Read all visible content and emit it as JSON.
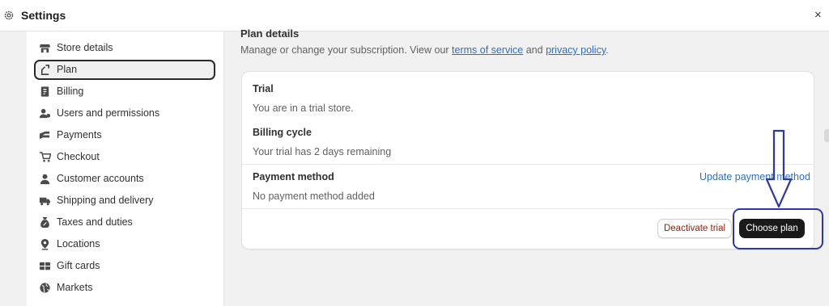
{
  "header": {
    "title": "Settings",
    "gear_icon": "gear-icon",
    "close_label": "×"
  },
  "sidebar": {
    "items": [
      {
        "label": "Store details",
        "icon": "store-icon",
        "active": false
      },
      {
        "label": "Plan",
        "icon": "plan-icon",
        "active": true
      },
      {
        "label": "Billing",
        "icon": "billing-icon",
        "active": false
      },
      {
        "label": "Users and permissions",
        "icon": "users-icon",
        "active": false
      },
      {
        "label": "Payments",
        "icon": "payments-icon",
        "active": false
      },
      {
        "label": "Checkout",
        "icon": "cart-icon",
        "active": false
      },
      {
        "label": "Customer accounts",
        "icon": "person-icon",
        "active": false
      },
      {
        "label": "Shipping and delivery",
        "icon": "truck-icon",
        "active": false
      },
      {
        "label": "Taxes and duties",
        "icon": "tax-icon",
        "active": false
      },
      {
        "label": "Locations",
        "icon": "location-icon",
        "active": false
      },
      {
        "label": "Gift cards",
        "icon": "gift-card-icon",
        "active": false
      },
      {
        "label": "Markets",
        "icon": "globe-icon",
        "active": false
      }
    ]
  },
  "main": {
    "section_title": "Plan details",
    "description_prefix": "Manage or change your subscription. View our ",
    "terms_link": "terms of service",
    "description_and": " and ",
    "privacy_link": "privacy policy",
    "description_suffix": ".",
    "card": {
      "trial_heading": "Trial",
      "trial_text": "You are in a trial store.",
      "billing_cycle_heading": "Billing cycle",
      "billing_cycle_text": "Your trial has 2 days remaining",
      "payment_method_heading": "Payment method",
      "payment_method_text": "No payment method added",
      "update_payment_link": "Update payment method",
      "deactivate_button": "Deactivate trial",
      "choose_plan_button": "Choose plan"
    }
  },
  "annotation": {
    "color": "#2b39a8",
    "arrow": "down-arrow-icon"
  }
}
